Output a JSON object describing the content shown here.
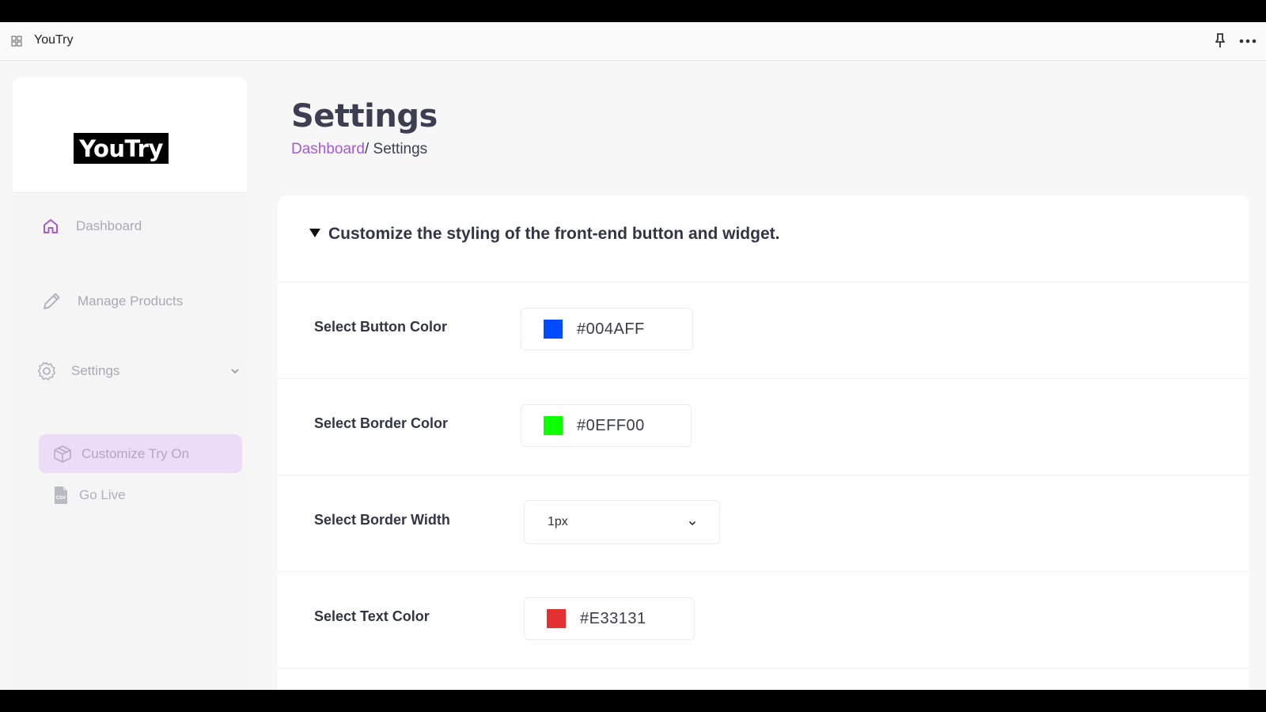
{
  "window": {
    "title": "YouTry"
  },
  "sidebar": {
    "logo_text": "YouTry",
    "items": [
      {
        "label": "Dashboard",
        "icon": "home-icon"
      },
      {
        "label": "Manage Products",
        "icon": "pencil-icon"
      },
      {
        "label": "Settings",
        "icon": "gear-icon",
        "expanded": true
      }
    ],
    "subitems": [
      {
        "label": "Customize Try On",
        "icon": "box-icon",
        "active": true
      },
      {
        "label": "Go Live",
        "icon": "csv-file-icon"
      }
    ]
  },
  "header": {
    "title": "Settings",
    "breadcrumb": {
      "link": "Dashboard",
      "separator": "/ ",
      "current": "Settings"
    }
  },
  "section": {
    "title": "Customize the styling of the front-end button and widget.",
    "fields": [
      {
        "label": "Select Button Color",
        "value": "#004AFF",
        "color": "#004AFF"
      },
      {
        "label": "Select Border Color",
        "value": "#0EFF00",
        "color": "#0EFF00"
      },
      {
        "label": "Select Border Width",
        "value": "1px"
      },
      {
        "label": "Select Text Color",
        "value": "#E33131",
        "color": "#E33131"
      }
    ]
  },
  "colors": {
    "accent": "#A45BD1",
    "active_bg": "#ECDCF7"
  }
}
